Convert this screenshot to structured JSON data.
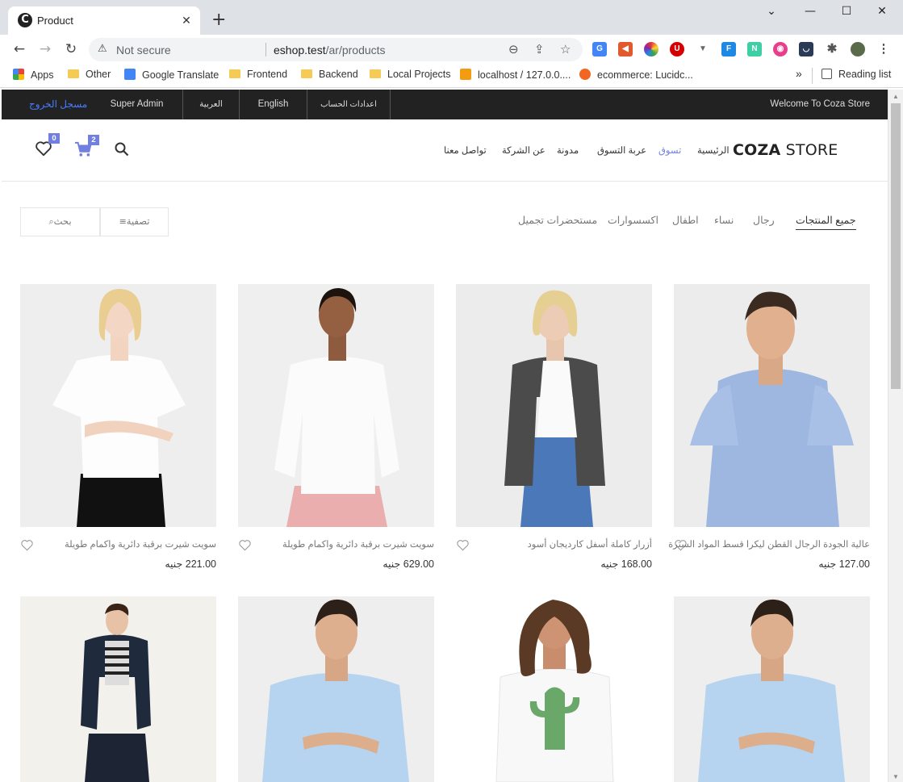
{
  "browser": {
    "tab_title": "Product",
    "tab_favicon_letter": "C",
    "url_warning": "Not secure",
    "url_host": "eshop.test",
    "url_path": "/ar/products",
    "bookmarks": [
      "Apps",
      "Other",
      "Google Translate",
      "Frontend",
      "Backend",
      "Local Projects",
      "localhost / 127.0.0....",
      "ecommerce: Lucidc..."
    ],
    "reading_list": "Reading list",
    "more_bookmarks": "»"
  },
  "topbar": {
    "welcome": "Welcome To Coza Store",
    "account_settings": "اعدادات الحساب",
    "lang_en": "English",
    "lang_ar": "العربية",
    "user": "Super Admin",
    "logout": "مسجل الخروج"
  },
  "header": {
    "logo_bold": "COZA",
    "logo_light": " STORE",
    "menu": [
      "الرئيسية",
      "تسوق",
      "عربة التسوق",
      "مدونة",
      "عن الشركة",
      "تواصل معنا"
    ],
    "active_menu": "تسوق",
    "wishlist_count": "0",
    "cart_count": "2"
  },
  "filters": {
    "categories": [
      "جميع المنتجات",
      "رجال",
      "نساء",
      "اطفال",
      "اكسسوارات",
      "مستحضرات تجميل"
    ],
    "filter_label": "تصفية",
    "search_label": "بحث"
  },
  "products": [
    {
      "name": "عالية الجودة الرجال القطن ليكرا قسط المواد السترة",
      "price": "127.00 جنيه"
    },
    {
      "name": "أزرار كاملة أسفل كارديجان أسود",
      "price": "168.00 جنيه"
    },
    {
      "name": "سويت شيرت برقبة دائرية واكمام طويلة",
      "price": "629.00 جنيه"
    },
    {
      "name": "سويت شيرت برقبة دائرية واكمام طويلة",
      "price": "221.00 جنيه"
    }
  ],
  "colors": {
    "accent": "#717fe0",
    "topbar": "#222222",
    "logout_link": "#4a7bff"
  }
}
